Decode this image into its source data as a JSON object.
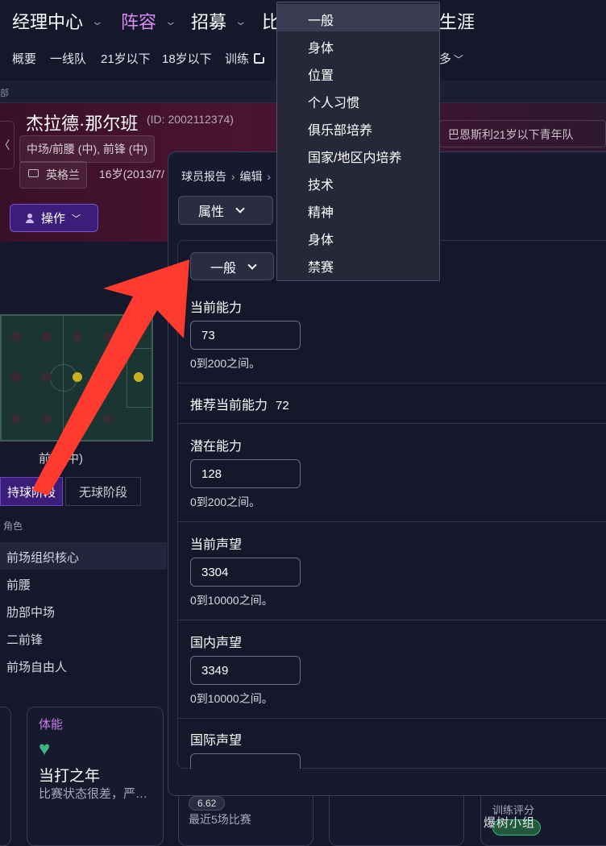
{
  "topnav": {
    "items": [
      {
        "label": "经理中心"
      },
      {
        "label": "阵容"
      },
      {
        "label": "招募"
      },
      {
        "label": "比"
      },
      {
        "label": "生涯"
      }
    ],
    "sub": [
      {
        "label": "概要"
      },
      {
        "label": "一线队"
      },
      {
        "label": "21岁以下"
      },
      {
        "label": "18岁以下"
      },
      {
        "label": "训练"
      },
      {
        "label": "多"
      }
    ],
    "accent": "#d98cf2"
  },
  "crumb_strip": {
    "text": "部"
  },
  "player": {
    "name": "杰拉德·那尔班",
    "id": "(ID: 2002112374)",
    "positions": "中场/前腰 (中), 前锋 (中)",
    "nation": "英格兰",
    "age": "16岁(2013/7/",
    "club": "巴恩斯利21岁以下青年队",
    "action_label": "操作"
  },
  "pitch": {
    "position_label": "前腰(中)"
  },
  "phase_tabs": {
    "in_possession": "持球阶段",
    "out_possession": "无球阶段"
  },
  "roles": {
    "header": "角色",
    "items": [
      "前场组织核心",
      "前腰",
      "肋部中场",
      "二前锋",
      "前场自由人"
    ]
  },
  "bottom_cards": {
    "fitness_title": "体能",
    "fitness_value": "当打之年",
    "fitness_desc": "比赛状态很差，严…",
    "rating_value": "6.62",
    "rating_label": "最近5场比赛",
    "training_label": "训练评分"
  },
  "modal": {
    "crumb_1": "球员报告",
    "crumb_2": "编辑",
    "attr_select": "属性",
    "general_select": "一般",
    "fields": {
      "ca_label": "当前能力",
      "ca_value": "73",
      "ca_hint": "0到200之间。",
      "rec_label": "推荐当前能力",
      "rec_value": "72",
      "pa_label": "潜在能力",
      "pa_value": "128",
      "pa_hint": "0到200之间。",
      "cr_label": "当前声望",
      "cr_value": "3304",
      "cr_hint": "0到10000之间。",
      "dr_label": "国内声望",
      "dr_value": "3349",
      "dr_hint": "0到10000之间。",
      "wr_label": "国际声望"
    }
  },
  "dropdown": {
    "options": [
      "一般",
      "身体",
      "位置",
      "个人习惯",
      "俱乐部培养",
      "国家/地区内培养",
      "技术",
      "精神",
      "身体",
      "禁赛"
    ],
    "selected": "一般"
  },
  "annotation": {
    "arrow_color": "#ff3b30"
  },
  "watermark": {
    "text": "爆树小组"
  }
}
